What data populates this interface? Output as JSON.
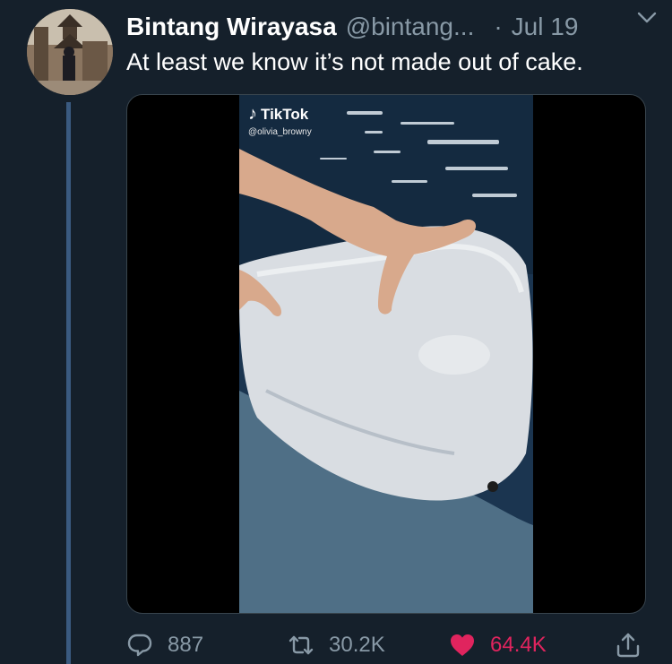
{
  "author": {
    "display_name": "Bintang Wirayasa",
    "handle": "@bintang...",
    "separator": "·",
    "date": "Jul 19"
  },
  "tweet": {
    "text": "At least we know it’s not made out of cake."
  },
  "media": {
    "watermark_brand": "TikTok",
    "watermark_user": "@olivia_browny"
  },
  "actions": {
    "reply_count": "887",
    "retweet_count": "30.2K",
    "like_count": "64.4K"
  },
  "colors": {
    "background": "#15202b",
    "secondary_text": "#8899a6",
    "like_active": "#e0245e",
    "thread_line": "#3a5a80"
  },
  "icons": {
    "menu": "chevron-down-icon",
    "reply": "reply-icon",
    "retweet": "retweet-icon",
    "like": "heart-icon",
    "share": "share-icon"
  }
}
